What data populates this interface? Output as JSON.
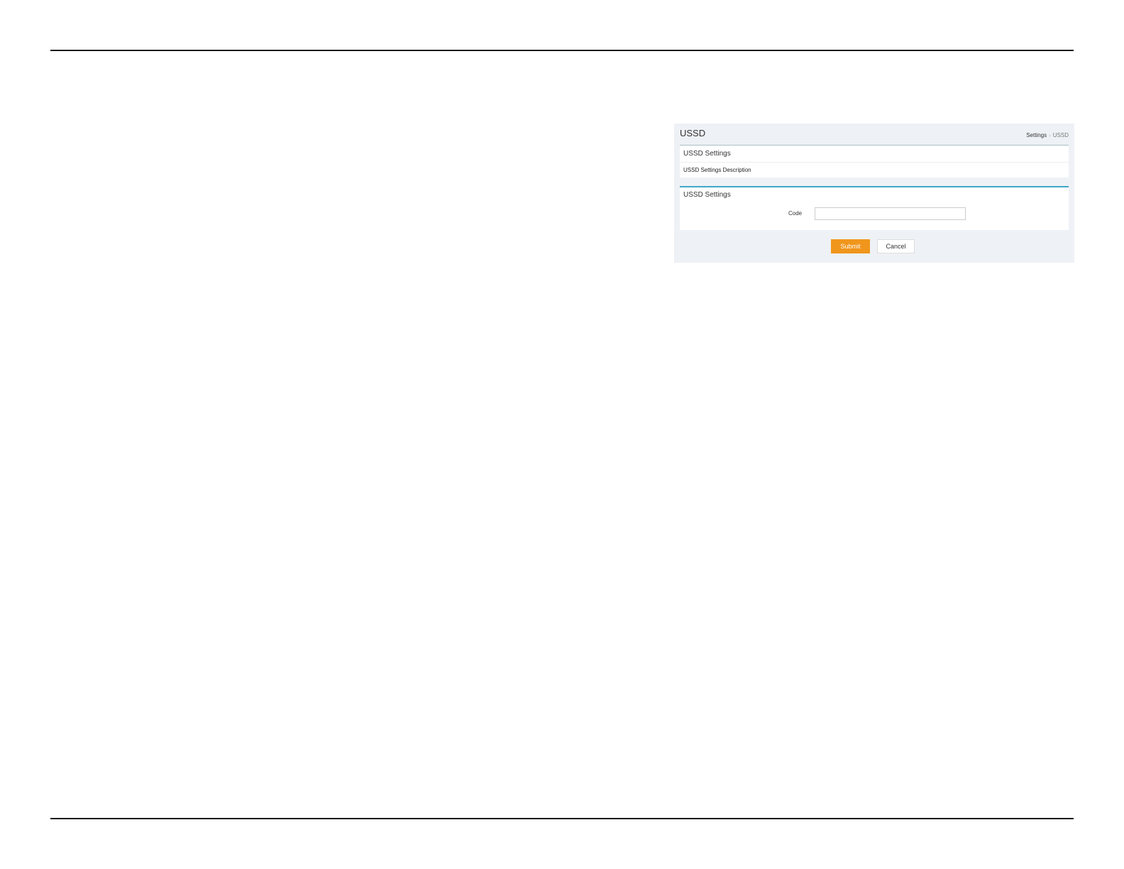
{
  "page": {
    "title": "USSD",
    "breadcrumb": {
      "parent": "Settings",
      "separator": "›",
      "current": "USSD"
    }
  },
  "description_panel": {
    "title": "USSD Settings",
    "text": "USSD Settings Description"
  },
  "form_panel": {
    "title": "USSD Settings",
    "code_label": "Code",
    "code_value": ""
  },
  "actions": {
    "submit_label": "Submit",
    "cancel_label": "Cancel"
  },
  "colors": {
    "accent": "#f0961c",
    "panel_top_border": "#3fa9c9",
    "background": "#eef1f5"
  }
}
